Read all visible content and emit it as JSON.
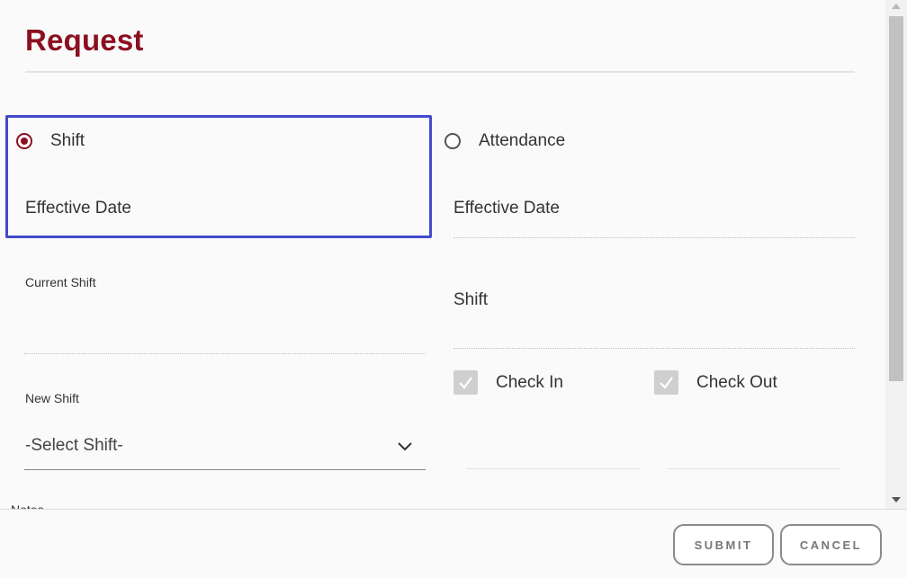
{
  "header": {
    "title": "Request"
  },
  "request_type": {
    "shift_label": "Shift",
    "attendance_label": "Attendance",
    "selected": "Shift"
  },
  "left": {
    "effective_date_label": "Effective Date",
    "current_shift_label": "Current Shift",
    "current_shift_value": "",
    "new_shift_label": "New Shift",
    "new_shift_value": "-Select Shift-",
    "notes_label": "Notes"
  },
  "right": {
    "effective_date_label": "Effective Date",
    "shift_label": "Shift",
    "check_in_label": "Check In",
    "check_out_label": "Check Out",
    "check_in_checked": true,
    "check_out_checked": true
  },
  "footer": {
    "submit_label": "SUBMIT",
    "cancel_label": "CANCEL"
  },
  "colors": {
    "accent": "#8b1020",
    "highlight": "#4349cc"
  }
}
